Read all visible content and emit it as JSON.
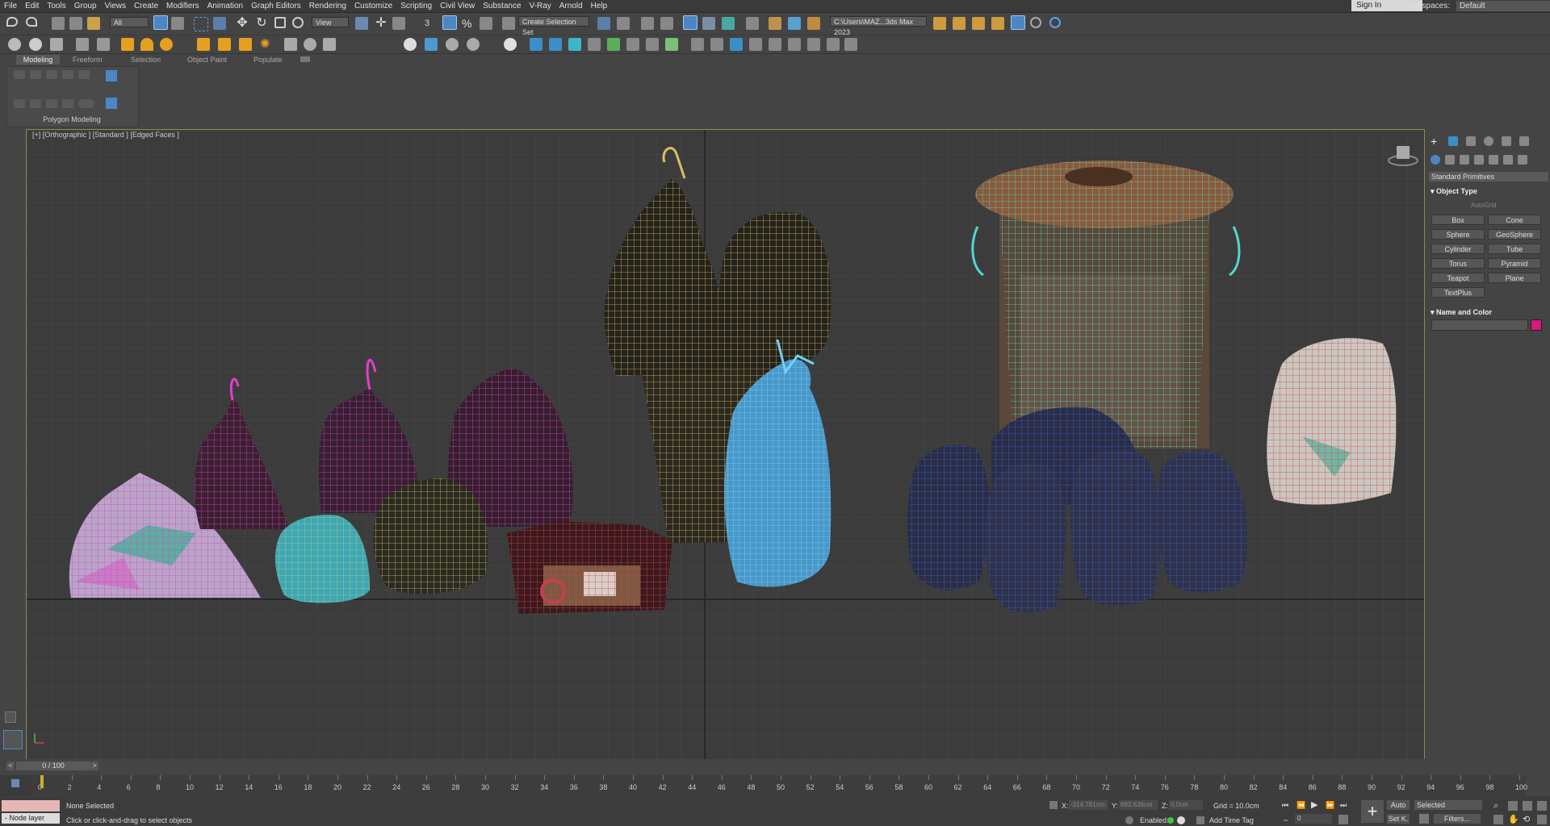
{
  "menu": [
    "File",
    "Edit",
    "Tools",
    "Group",
    "Views",
    "Create",
    "Modifiers",
    "Animation",
    "Graph Editors",
    "Rendering",
    "Customize",
    "Scripting",
    "Civil View",
    "Substance",
    "V-Ray",
    "Arnold",
    "Help"
  ],
  "header": {
    "sign_in": "Sign In",
    "workspaces_label": "Workspaces:",
    "workspace_value": "Default"
  },
  "toolbar": {
    "filter_value": "All",
    "ref_coord_value": "View",
    "selection_set": "Create Selection Set",
    "project_path": "C:\\Users\\MAZ...3ds Max 2023"
  },
  "ribbon": {
    "tabs": [
      "Modeling",
      "Freeform",
      "Selection",
      "Object Paint",
      "Populate"
    ],
    "panel_label": "Polygon Modeling"
  },
  "viewport": {
    "label": "[+] [Orthographic ] [Standard ] [Edged Faces ]"
  },
  "command_panel": {
    "category": "Standard Primitives",
    "object_type_title": "Object Type",
    "autogrid": "AutoGrid",
    "buttons": [
      "Box",
      "Cone",
      "Sphere",
      "GeoSphere",
      "Cylinder",
      "Tube",
      "Torus",
      "Pyramid",
      "Teapot",
      "Plane",
      "TextPlus"
    ],
    "name_color_title": "Name and Color",
    "swatch_color": "#d81a7a"
  },
  "timeline": {
    "frame_display": "0 / 100",
    "ticks": [
      "0",
      "2",
      "4",
      "6",
      "8",
      "10",
      "12",
      "14",
      "16",
      "18",
      "20",
      "22",
      "24",
      "26",
      "28",
      "30",
      "32",
      "34",
      "36",
      "38",
      "40",
      "42",
      "44",
      "46",
      "48",
      "50",
      "52",
      "54",
      "56",
      "58",
      "60",
      "62",
      "64",
      "66",
      "68",
      "70",
      "72",
      "74",
      "76",
      "78",
      "80",
      "82",
      "84",
      "86",
      "88",
      "90",
      "92",
      "94",
      "96",
      "98",
      "100"
    ]
  },
  "status": {
    "node_layer": "- Node layer",
    "selection": "None Selected",
    "prompt": "Click or click-and-drag to select objects",
    "x_label": "X:",
    "x_value": "-314.781cm",
    "y_label": "Y:",
    "y_value": "683.636cm",
    "z_label": "Z:",
    "z_value": "0.0cm",
    "grid": "Grid = 10.0cm",
    "enabled": "Enabled:",
    "add_time_tag": "Add Time Tag",
    "auto": "Auto",
    "selected_value": "Selected",
    "set_key": "Set K.",
    "filters": "Filters...",
    "current_frame": "0"
  }
}
